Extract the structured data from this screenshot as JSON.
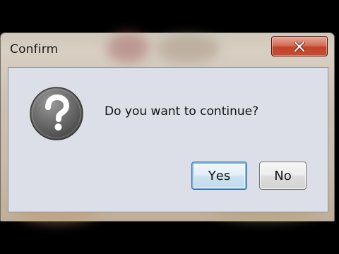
{
  "window": {
    "title": "Confirm",
    "close_icon": "close-icon"
  },
  "dialog": {
    "icon": "question-icon",
    "message": "Do you want to continue?",
    "buttons": [
      {
        "label_mnemonic": "Y",
        "label_rest": "es",
        "full_label": "Yes",
        "default": true
      },
      {
        "label_mnemonic": "N",
        "label_rest": "o",
        "full_label": "No",
        "default": false
      }
    ]
  },
  "colors": {
    "close_button": "#c94a2e",
    "client_background": "#dcdfe7",
    "default_button_border": "#3b6a93"
  }
}
